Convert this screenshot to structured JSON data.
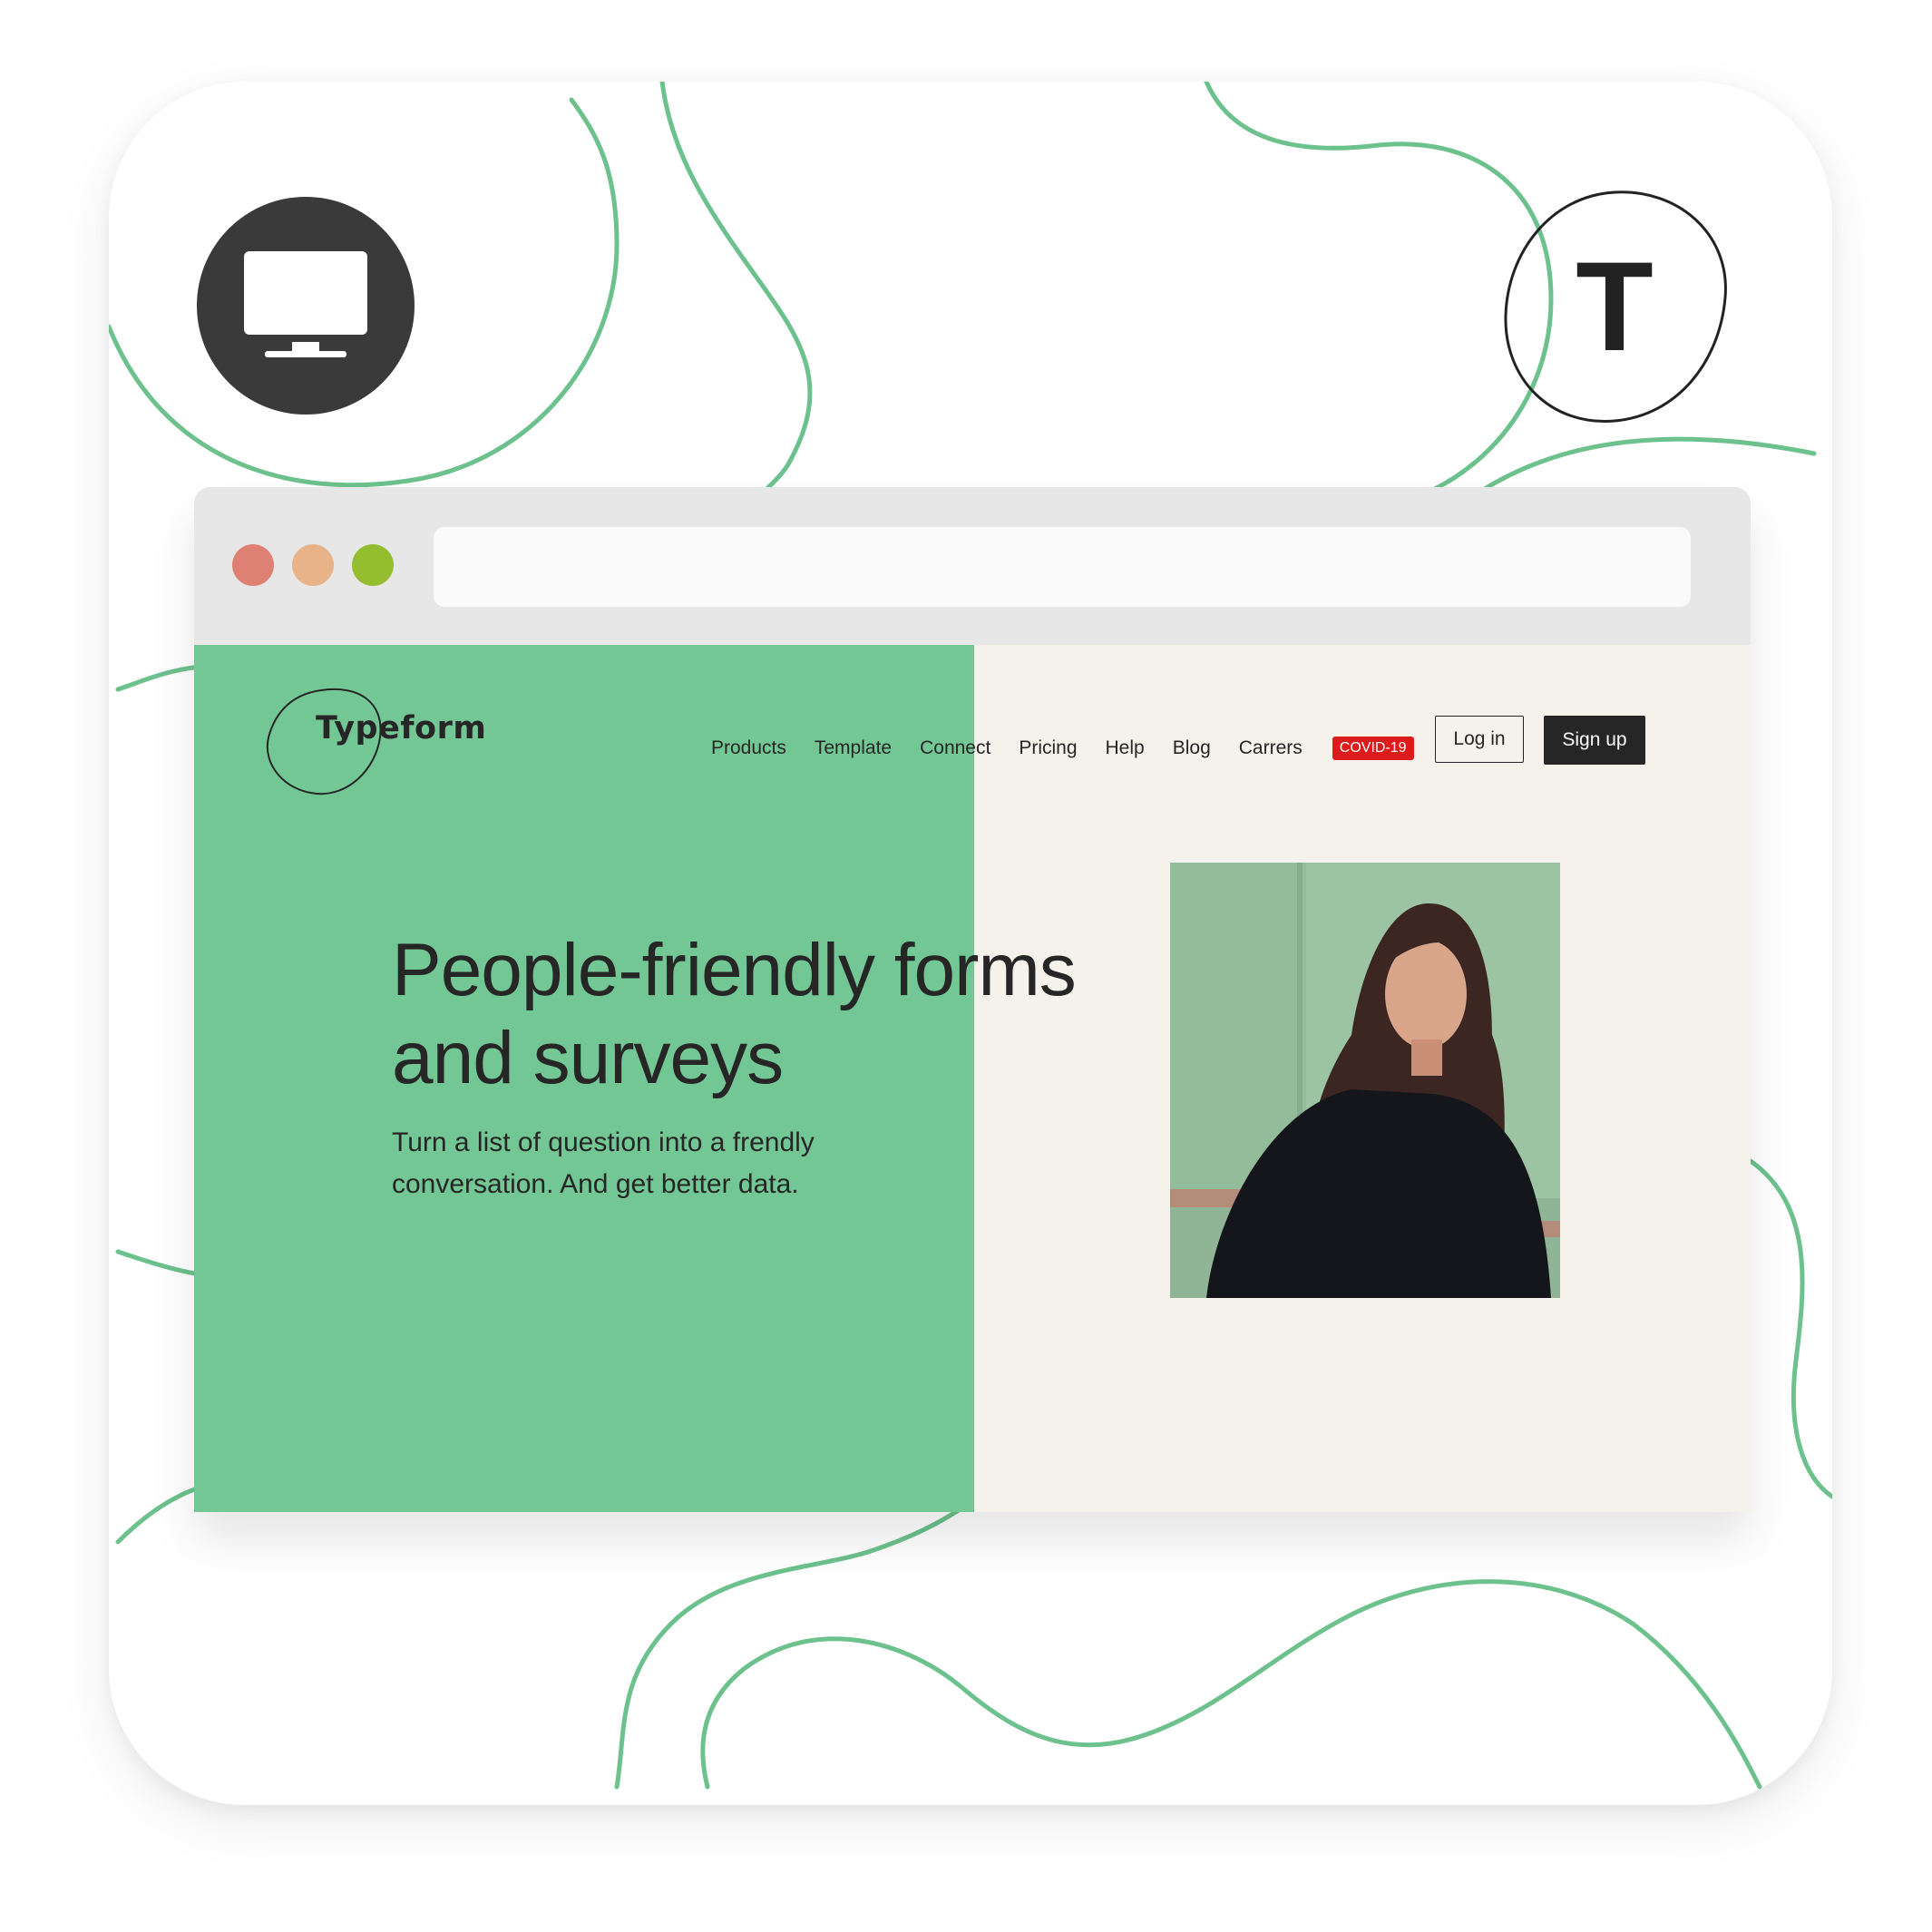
{
  "site": {
    "logo": "Typeform",
    "nav": [
      "Products",
      "Template",
      "Connect",
      "Pricing",
      "Help",
      "Blog",
      "Carrers"
    ],
    "badge": "COVID-19",
    "login": "Log in",
    "signup": "Sign up"
  },
  "hero": {
    "headline_line1": "People-friendly forms",
    "headline_line2": "and surveys",
    "subtext_line1": "Turn a list of question into a frendly",
    "subtext_line2": "conversation. And get better data."
  },
  "brand_badge": {
    "letter": "T"
  },
  "address_bar": {
    "value": ""
  },
  "colors": {
    "green": "#72c794",
    "cream": "#f4f2eb",
    "dark": "#262626",
    "badge_red": "#dc1b1b",
    "traffic_red": "#df8075",
    "traffic_orange": "#e9b389",
    "traffic_green": "#94bd2f",
    "curve_green": "#6cc18d"
  },
  "icons": {
    "device": "monitor-icon",
    "brand": "typeform-t-icon"
  }
}
